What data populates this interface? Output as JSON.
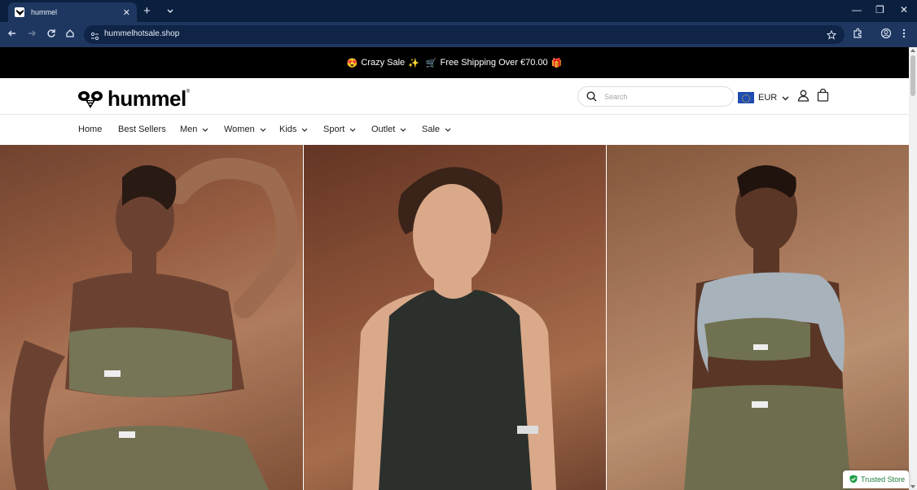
{
  "browser": {
    "tab_title": "hummel",
    "tab_close": "✕",
    "new_tab": "+",
    "url": "hummelhotsale.shop",
    "window_controls": [
      "—",
      "❐",
      "✕"
    ]
  },
  "announcement": {
    "emoji_left": "😍",
    "sale_text": "Crazy Sale",
    "sparkle": "✨",
    "cart_emoji": "🛒",
    "shipping_text": "Free Shipping Over €70.00",
    "gift": "🎁"
  },
  "header": {
    "logo_text": "hummel",
    "logo_reg": "®",
    "search_placeholder": "Search",
    "currency_code": "EUR"
  },
  "menu": {
    "items": [
      {
        "label": "Home",
        "has_dropdown": false
      },
      {
        "label": "Best Sellers",
        "has_dropdown": false
      },
      {
        "label": "Men",
        "has_dropdown": true
      },
      {
        "label": "Women",
        "has_dropdown": true
      },
      {
        "label": "Kids",
        "has_dropdown": true
      },
      {
        "label": "Sport",
        "has_dropdown": true
      },
      {
        "label": "Outlet",
        "has_dropdown": true
      },
      {
        "label": "Sale",
        "has_dropdown": true
      }
    ]
  },
  "hero": {
    "panels": [
      "woman-sports-bra",
      "man-tank-top",
      "woman-jacket-tied"
    ]
  },
  "badge": {
    "label": "Trusted Store"
  },
  "colors": {
    "browser_frame": "#0b1f3f",
    "browser_toolbar": "#1e3760",
    "announcement_bg": "#000000",
    "trusted_green": "#1f7a3b"
  }
}
